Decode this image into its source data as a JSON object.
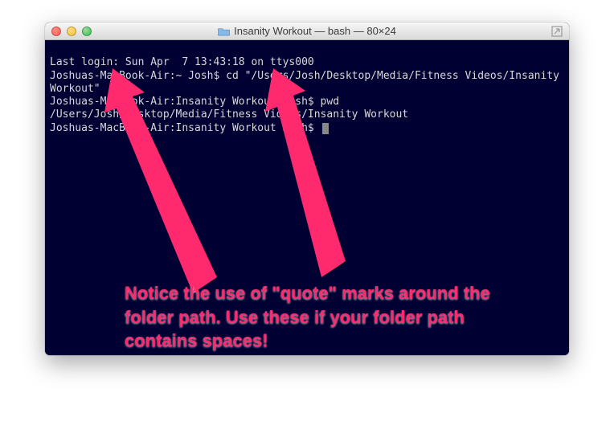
{
  "window": {
    "title": "Insanity Workout — bash — 80×24"
  },
  "terminal": {
    "lines": {
      "l0": "Last login: Sun Apr  7 13:43:18 on ttys000",
      "l1": "Joshuas-MacBook-Air:~ Josh$ cd \"/Users/Josh/Desktop/Media/Fitness Videos/Insanity Workout\"",
      "l2": "Joshuas-MacBook-Air:Insanity Workout Josh$ pwd",
      "l3": "/Users/Josh/Desktop/Media/Fitness Videos/Insanity Workout",
      "l4": "Joshuas-MacBook-Air:Insanity Workout Josh$ "
    }
  },
  "annotation": {
    "text": "Notice the use of \"quote\" marks around the folder path. Use these if your folder path contains spaces!"
  },
  "colors": {
    "accent": "#ff2a6d",
    "term_bg": "#000033",
    "term_fg": "#d8d8d8"
  }
}
